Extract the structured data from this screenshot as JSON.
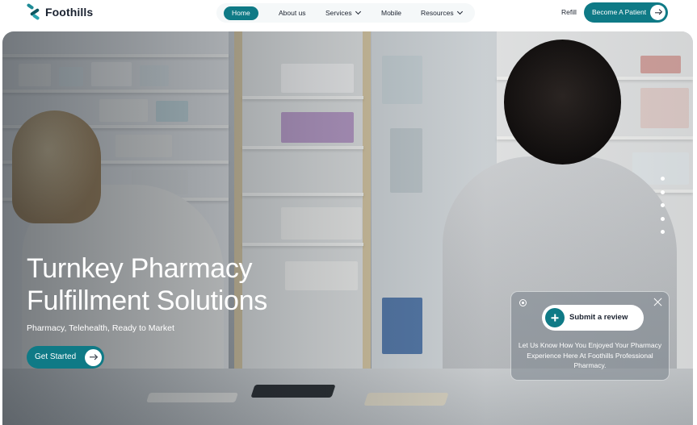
{
  "brand": {
    "name": "Foothills",
    "accent": "#0f7a86"
  },
  "nav": {
    "items": [
      {
        "label": "Home",
        "active": true
      },
      {
        "label": "About us",
        "active": false
      },
      {
        "label": "Services",
        "active": false,
        "dropdown": true
      },
      {
        "label": "Mobile",
        "active": false
      },
      {
        "label": "Resources",
        "active": false,
        "dropdown": true
      }
    ],
    "refill_label": "Refill",
    "cta_label": "Become A Patient"
  },
  "hero": {
    "headline_line1": "Turnkey Pharmacy",
    "headline_line2": "Fulfillment Solutions",
    "subtitle": "Pharmacy, Telehealth, Ready to Market",
    "cta_label": "Get Started",
    "slide_indicators": 5
  },
  "review_card": {
    "button_label": "Submit a review",
    "message": "Let Us Know How You Enjoyed Your Pharmacy Experience Here At Foothills Professional Pharmacy."
  },
  "icons": {
    "logo": "foothills-logo-mark",
    "arrow": "arrow-right-icon",
    "chevron": "chevron-down-icon",
    "plus": "plus-icon",
    "close": "close-icon",
    "settings": "settings-icon"
  }
}
